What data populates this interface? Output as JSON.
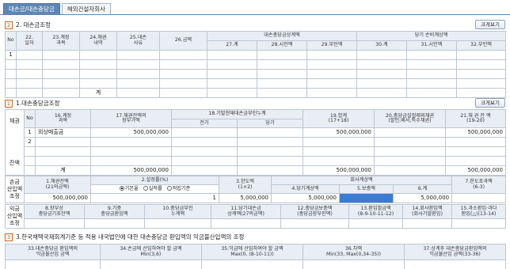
{
  "tabs": [
    "대손금/대손충당금",
    "해외건설자회사"
  ],
  "view_button": "크게보기",
  "section2": {
    "num": "2",
    "title": "2. 대손금조정",
    "h_no": "No",
    "h_date": "22.\n일자",
    "h_account": "23.계정\n과목",
    "h_bond": "24.채권\n내역",
    "h_reason": "25.대손\n사유",
    "h_amount": "26.금액",
    "h_group1": "대손충당금상계액",
    "h_group2": "당기 손비계상액",
    "h_c27": "27.계",
    "h_c28": "28.시인액",
    "h_c29": "29.부인액",
    "h_c30": "30.계",
    "h_c31": "31.시인액",
    "h_c32": "32.부인액",
    "row1_no": "1",
    "total_label": "계"
  },
  "section1": {
    "num": "1",
    "title": "1.대손충당금조정",
    "side1": "채권",
    "side2": "잔액",
    "h_no": "No",
    "h16": "16.계정\n과목",
    "h17": "17.채권잔액의\n장부가액",
    "h18": "18.기말현재대손금부인누계",
    "h18a": "전기",
    "h18b": "당기",
    "h19": "19.합계\n(17+18)",
    "h20": "20.충당금설정제외채권\n(할인,배서,특수채권)",
    "h21": "21.채 권 잔 액\n(19-20)",
    "r1_no": "1",
    "r1_account": "외상매출금",
    "r1_book": "500,000,000",
    "r1_sum": "500,000,000",
    "r1_balance": "500,000,000",
    "r2_no": "2",
    "total_label": "계",
    "total_book": "500,000,000",
    "total_sum": "500,000,000",
    "total_balance": "500,000,000"
  },
  "adjust": {
    "side_label": "손금\n산입액\n조정",
    "h1": "1.채권잔액\n(21의금액)",
    "h2": "2.설정률(%)",
    "radio1": "기본율",
    "radio2": "실적률",
    "radio3": "적립기준",
    "h3": "3.한도액\n(1×2)",
    "h_company": "회사계상액",
    "h4": "4.당기계상액",
    "h5": "5.보충액",
    "h6": "6.계",
    "h7": "7.한도초과액\n(6-3)",
    "v1": "500,000,000",
    "v2": "1",
    "v3": "5,000,000",
    "v4": "5,000,000",
    "v6": "5,000,000",
    "v7": ""
  },
  "profit": {
    "side_label": "익금\n산입액\n조정",
    "h8": "8.장부상\n충당금기초잔액",
    "h9": "9.기중\n충당금환입액",
    "h10": "10.충당금부인\n누계액",
    "h11": "11.당기대손금\n상계액(27의금액)",
    "h12": "12.충당금보충액\n(충당금장부잔액)",
    "h13": "13.환입할금액\n(8-9-10-11-12)",
    "h14": "14.회사환입액\n(회사기말환입)",
    "h15": "15.과소환입·과다\n환입(△)(13-14)"
  },
  "section3": {
    "num": "3",
    "title": "3.한국채택국제회계기준 등 적용 내국법인에 대한 대손충당금 환입액의 익금불산입액의 조정",
    "h33": "33.대손충당금 환입액의\n익금불산입 금액",
    "h34": "34.손금에 산입하여야 할 금액\nMin(3,6)",
    "h35": "35.익금에 산입하여야 할 금액\nMax(0, (8-10-11))",
    "h36": "36.차액\nMin(33, Max(0,34-35))",
    "h37": "37.상계후 대손충당금환입액의\n익금불산입 금액(33-36)"
  },
  "colors": {
    "tab_active": "#5d86b5",
    "header_bg": "#e9eef4",
    "selected_cell": "#3a7bd5",
    "section_marker": "#c76b1b"
  }
}
